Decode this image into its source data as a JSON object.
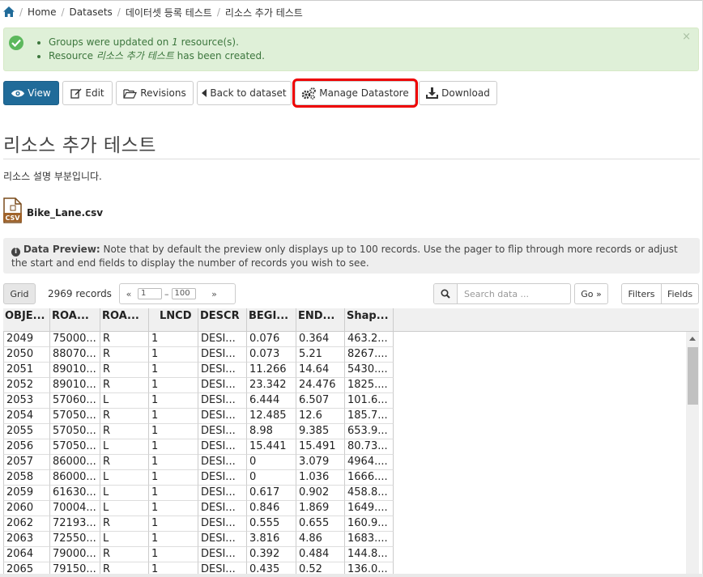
{
  "breadcrumb": {
    "home_icon": "home-icon",
    "items": [
      "Home",
      "Datasets",
      "데이터셋 등록 테스트",
      "리소스 추가 테스트"
    ]
  },
  "alert": {
    "line1_a": "Groups were updated on ",
    "line1_b": "1",
    "line1_c": " resource(s).",
    "line2_a": "Resource ",
    "line2_b": "리소스 추가 테스트",
    "line2_c": " has been created.",
    "close": "×"
  },
  "toolbar": {
    "view": "View",
    "edit": "Edit",
    "revisions": "Revisions",
    "back": "Back to dataset",
    "datastore": "Manage Datastore",
    "download": "Download"
  },
  "resource": {
    "title": "리소스 추가 테스트",
    "description": "리소스 설명 부분입니다.",
    "file_name": "Bike_Lane.csv",
    "file_icon": "csv-file-icon"
  },
  "preview": {
    "label": "Data Preview:",
    "text": " Note that by default the preview only displays up to 100 records. Use the pager to flip through more records or adjust the start and end fields to display the number of records you wish to see."
  },
  "grid": {
    "grid_btn": "Grid",
    "records": "2969 records",
    "prev": "«",
    "from": "1",
    "dash": "–",
    "to": "100",
    "next": "»",
    "search_placeholder": "Search data ...",
    "go": "Go »",
    "filters": "Filters",
    "fields": "Fields"
  },
  "table": {
    "columns": [
      "OBJE...",
      "ROA...",
      "ROA...",
      "LNCD",
      "DESCR",
      "BEGI...",
      "END...",
      "Shap..."
    ],
    "rows": [
      [
        "2049",
        "75000...",
        "R",
        "1",
        "DESI...",
        "0.076",
        "0.364",
        "463.2..."
      ],
      [
        "2050",
        "88070...",
        "R",
        "1",
        "DESI...",
        "0.073",
        "5.21",
        "8267...."
      ],
      [
        "2051",
        "89010...",
        "R",
        "1",
        "DESI...",
        "11.266",
        "14.64",
        "5430...."
      ],
      [
        "2052",
        "89010...",
        "R",
        "1",
        "DESI...",
        "23.342",
        "24.476",
        "1825...."
      ],
      [
        "2053",
        "57060...",
        "L",
        "1",
        "DESI...",
        "6.444",
        "6.507",
        "101.6..."
      ],
      [
        "2054",
        "57050...",
        "R",
        "1",
        "DESI...",
        "12.485",
        "12.6",
        "185.7..."
      ],
      [
        "2055",
        "57050...",
        "R",
        "1",
        "DESI...",
        "8.98",
        "9.385",
        "653.9..."
      ],
      [
        "2056",
        "57050...",
        "L",
        "1",
        "DESI...",
        "15.441",
        "15.491",
        "80.73..."
      ],
      [
        "2057",
        "86000...",
        "R",
        "1",
        "DESI...",
        "0",
        "3.079",
        "4964...."
      ],
      [
        "2058",
        "86000...",
        "L",
        "1",
        "DESI...",
        "0",
        "1.036",
        "1666...."
      ],
      [
        "2059",
        "61630...",
        "L",
        "1",
        "DESI...",
        "0.617",
        "0.902",
        "458.8..."
      ],
      [
        "2060",
        "70004...",
        "L",
        "1",
        "DESI...",
        "0.846",
        "1.869",
        "1649...."
      ],
      [
        "2062",
        "72193...",
        "R",
        "1",
        "DESI...",
        "0.555",
        "0.655",
        "160.9..."
      ],
      [
        "2063",
        "72550...",
        "L",
        "1",
        "DESI...",
        "3.816",
        "4.86",
        "1683...."
      ],
      [
        "2064",
        "79000...",
        "R",
        "1",
        "DESI...",
        "0.392",
        "0.484",
        "144.8..."
      ],
      [
        "2065",
        "79150...",
        "R",
        "1",
        "DESI...",
        "0.435",
        "0.52",
        "136.0..."
      ]
    ]
  },
  "colors": {
    "primary": "#206b99",
    "success_bg": "#dff0d8",
    "success_text": "#3c763d",
    "highlight": "#ee0000"
  }
}
